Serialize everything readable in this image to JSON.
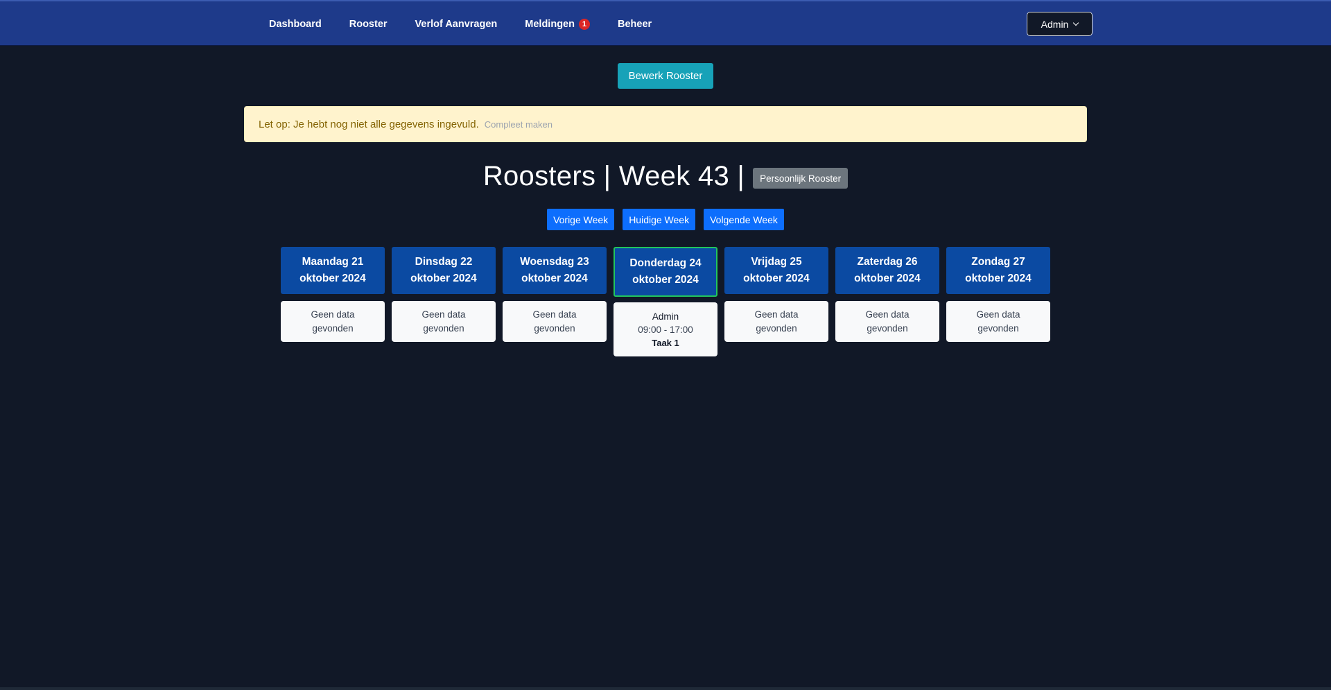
{
  "nav": {
    "items": [
      {
        "label": "Dashboard"
      },
      {
        "label": "Rooster"
      },
      {
        "label": "Verlof Aanvragen"
      },
      {
        "label": "Meldingen",
        "badge": "1"
      },
      {
        "label": "Beheer"
      }
    ],
    "user_menu": "Admin"
  },
  "actions": {
    "edit_schedule": "Bewerk Rooster"
  },
  "alert": {
    "text": "Let op: Je hebt nog niet alle gegevens ingevuld.",
    "link": "Compleet maken"
  },
  "heading": {
    "title": "Roosters | Week 43 |",
    "personal_button": "Persoonlijk Rooster"
  },
  "week_nav": {
    "previous": "Vorige Week",
    "current": "Huidige Week",
    "next": "Volgende Week"
  },
  "days": [
    {
      "title": "Maandag 21 oktober 2024",
      "empty": "Geen data gevonden"
    },
    {
      "title": "Dinsdag 22 oktober 2024",
      "empty": "Geen data gevonden"
    },
    {
      "title": "Woensdag 23 oktober 2024",
      "empty": "Geen data gevonden"
    },
    {
      "title": "Donderdag 24 oktober 2024",
      "today": true,
      "entry": {
        "name": "Admin",
        "time": "09:00 - 17:00",
        "task": "Taak 1"
      }
    },
    {
      "title": "Vrijdag 25 oktober 2024",
      "empty": "Geen data gevonden"
    },
    {
      "title": "Zaterdag 26 oktober 2024",
      "empty": "Geen data gevonden"
    },
    {
      "title": "Zondag 27 oktober 2024",
      "empty": "Geen data gevonden"
    }
  ],
  "colors": {
    "background": "#111827",
    "navbar": "#1e3a8a",
    "day_header": "#0b4aa2",
    "today_border": "#22c55e",
    "edit_button": "#17a2b8",
    "week_button": "#0d6efd",
    "alert_bg": "#fff3cd"
  }
}
